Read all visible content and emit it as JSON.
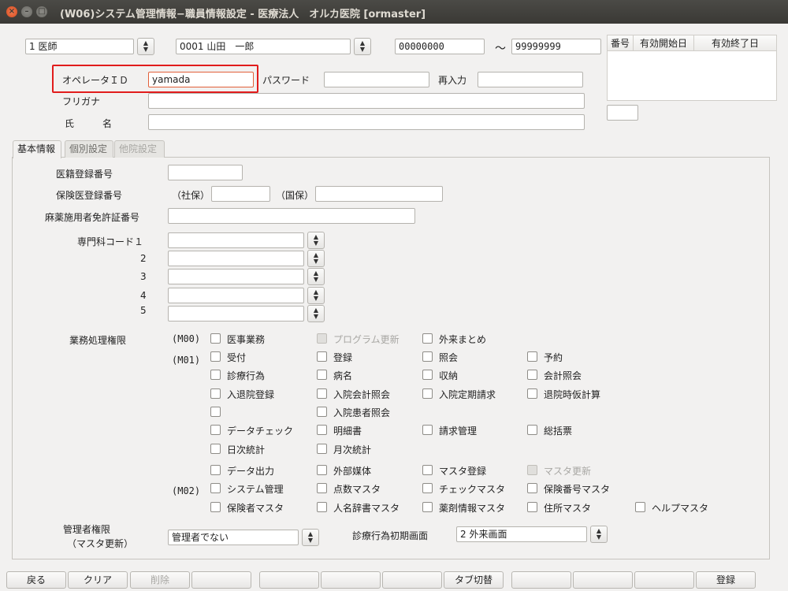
{
  "window": {
    "title": "(W06)システム管理情報−職員情報設定 - 医療法人　オルカ医院 [ormaster]"
  },
  "header": {
    "occupation": "1 医師",
    "staff": "0001 山田　一郎",
    "range_from": "00000000",
    "range_sep": "〜",
    "range_to": "99999999",
    "operator_label": "オペレータＩＤ",
    "operator_value": "yamada",
    "password_label": "パスワード",
    "password_value": "",
    "reenter_label": "再入力",
    "reenter_value": "",
    "furigana_label": "フリガナ",
    "furigana_value": "",
    "name_label": "氏　　　名",
    "name_value": ""
  },
  "history": {
    "columns": [
      "番号",
      "有効開始日",
      "有効終了日"
    ],
    "rows": []
  },
  "tabs": [
    "基本情報",
    "個別設定",
    "他院設定"
  ],
  "basic": {
    "medical_reg_label": "医籍登録番号",
    "insurance_reg_label": "保険医登録番号",
    "shaho_label": "（社保）",
    "kokuho_label": "（国保）",
    "narcotic_label": "麻薬施用者免許証番号",
    "specialty_label": "専門科コード１",
    "specialty_nums": [
      "2",
      "3",
      "4",
      "5"
    ],
    "perm_label": "業務処理権限",
    "group_m00": "(M00)",
    "group_m01": "(M01)",
    "group_m02": "(M02)",
    "perms": {
      "p1": "医事業務",
      "p2": "プログラム更新",
      "p3": "外来まとめ",
      "p4": "受付",
      "p5": "登録",
      "p6": "照会",
      "p7": "予約",
      "p8": "診療行為",
      "p9": "病名",
      "p10": "収納",
      "p11": "会計照会",
      "p12": "入退院登録",
      "p13": "入院会計照会",
      "p14": "入院定期請求",
      "p15": "退院時仮計算",
      "p16": "入院患者照会",
      "p17": "データチェック",
      "p18": "明細書",
      "p19": "請求管理",
      "p20": "総括票",
      "p21": "日次統計",
      "p22": "月次統計",
      "p23": "データ出力",
      "p24": "外部媒体",
      "p25": "マスタ登録",
      "p26": "マスタ更新",
      "p27": "システム管理",
      "p28": "点数マスタ",
      "p29": "チェックマスタ",
      "p30": "保険番号マスタ",
      "p31": "保険者マスタ",
      "p32": "人名辞書マスタ",
      "p33": "薬剤情報マスタ",
      "p34": "住所マスタ",
      "p35": "ヘルプマスタ"
    },
    "admin_label_1": "管理者権限",
    "admin_label_2": "（マスタ更新）",
    "admin_value": "管理者でない",
    "initial_screen_label": "診療行為初期画面",
    "initial_screen_value": "2 外来画面"
  },
  "footer": {
    "back": "戻る",
    "clear": "クリア",
    "delete": "削除",
    "tab_switch": "タブ切替",
    "register": "登録"
  }
}
